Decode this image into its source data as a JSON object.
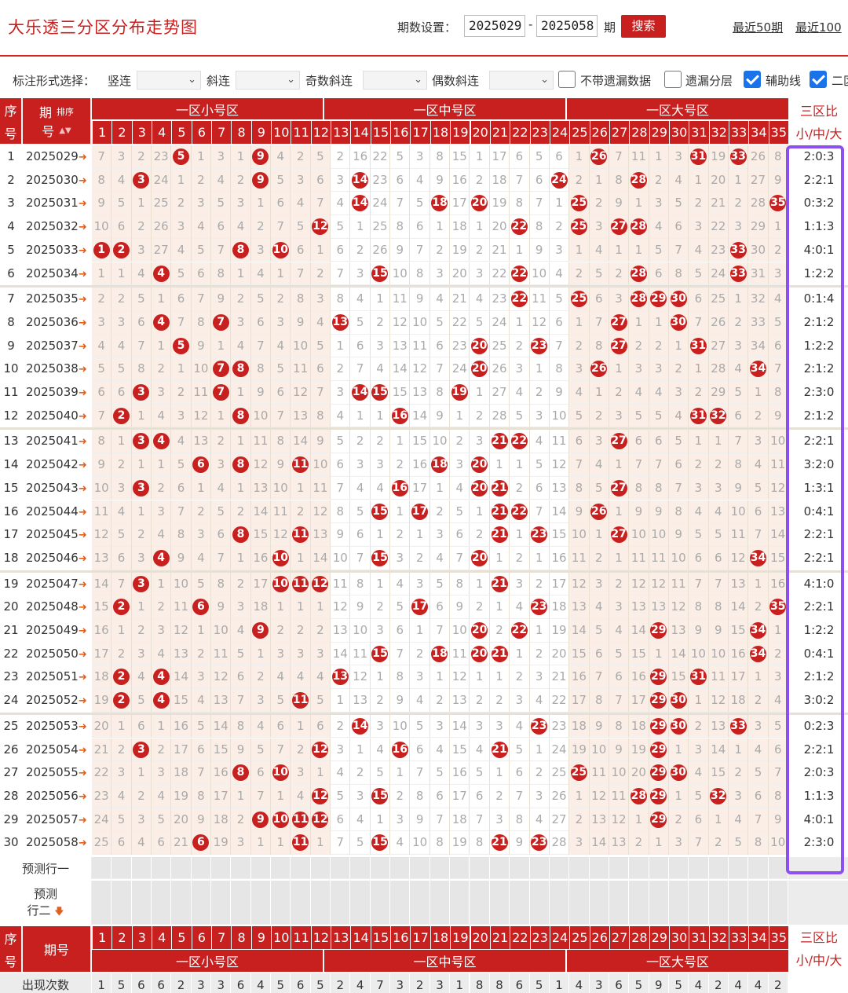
{
  "title": "大乐透三分区分布走势图",
  "period_label": "期数设置：",
  "period_from": "2025029",
  "period_dash": "-",
  "period_to": "2025058",
  "qi": "期",
  "search_label": "搜索",
  "link_recent50": "最近50期",
  "link_recent100": "最近100",
  "options": {
    "label": "标注形式选择：",
    "vertical": "竖连",
    "diagonal": "斜连",
    "odd_diagonal": "奇数斜连",
    "even_diagonal": "偶数斜连",
    "no_missing": "不带遗漏数据",
    "missing_layers": "遗漏分层",
    "aux_line": "辅助线",
    "second": "二区"
  },
  "colors": {
    "red": "#c81f1f",
    "purple": "#8c4ff0",
    "small_bg": "#fbeee6",
    "mid_bg": "#ffffff",
    "big_bg": "#fbeee6"
  },
  "header": {
    "seq_top": "序",
    "seq_bottom": "号",
    "period_top": "期",
    "period_bottom": "号",
    "sort": "排序",
    "zone_small": "一区小号区",
    "zone_mid": "一区中号区",
    "zone_big": "一区大号区",
    "ratio_top": "三区比",
    "ratio_bottom": "小/中/大"
  },
  "numbers": [
    "1",
    "2",
    "3",
    "4",
    "5",
    "6",
    "7",
    "8",
    "9",
    "10",
    "11",
    "12",
    "13",
    "14",
    "15",
    "16",
    "17",
    "18",
    "19",
    "20",
    "21",
    "22",
    "23",
    "24",
    "25",
    "26",
    "27",
    "28",
    "29",
    "30",
    "31",
    "32",
    "33",
    "34",
    "35"
  ],
  "rows": [
    {
      "seq": "1",
      "period": "2025029",
      "cells": [
        "7",
        "3",
        "2",
        "23",
        "*5",
        "1",
        "3",
        "1",
        "*9",
        "4",
        "2",
        "5",
        "2",
        "16",
        "22",
        "5",
        "3",
        "8",
        "15",
        "1",
        "17",
        "6",
        "5",
        "6",
        "1",
        "*26",
        "7",
        "11",
        "1",
        "3",
        "*31",
        "19",
        "*33",
        "26",
        "8"
      ],
      "ratio": "2:0:3"
    },
    {
      "seq": "2",
      "period": "2025030",
      "cells": [
        "8",
        "4",
        "*3",
        "24",
        "1",
        "2",
        "4",
        "2",
        "*9",
        "5",
        "3",
        "6",
        "3",
        "*14",
        "23",
        "6",
        "4",
        "9",
        "16",
        "2",
        "18",
        "7",
        "6",
        "*24",
        "2",
        "1",
        "8",
        "*28",
        "2",
        "4",
        "1",
        "20",
        "1",
        "27",
        "9"
      ],
      "ratio": "2:2:1"
    },
    {
      "seq": "3",
      "period": "2025031",
      "cells": [
        "9",
        "5",
        "1",
        "25",
        "2",
        "3",
        "5",
        "3",
        "1",
        "6",
        "4",
        "7",
        "4",
        "*14",
        "24",
        "7",
        "5",
        "*18",
        "17",
        "*20",
        "19",
        "8",
        "7",
        "1",
        "*25",
        "2",
        "9",
        "1",
        "3",
        "5",
        "2",
        "21",
        "2",
        "28",
        "*35"
      ],
      "ratio": "0:3:2"
    },
    {
      "seq": "4",
      "period": "2025032",
      "cells": [
        "10",
        "6",
        "2",
        "26",
        "3",
        "4",
        "6",
        "4",
        "2",
        "7",
        "5",
        "*12",
        "5",
        "1",
        "25",
        "8",
        "6",
        "1",
        "18",
        "1",
        "20",
        "*22",
        "8",
        "2",
        "*25",
        "3",
        "*27",
        "*28",
        "4",
        "6",
        "3",
        "22",
        "3",
        "29",
        "1"
      ],
      "ratio": "1:1:3"
    },
    {
      "seq": "5",
      "period": "2025033",
      "cells": [
        "*1",
        "*2",
        "3",
        "27",
        "4",
        "5",
        "7",
        "*8",
        "3",
        "*10",
        "6",
        "1",
        "6",
        "2",
        "26",
        "9",
        "7",
        "2",
        "19",
        "2",
        "21",
        "1",
        "9",
        "3",
        "1",
        "4",
        "1",
        "1",
        "5",
        "7",
        "4",
        "23",
        "*33",
        "30",
        "2"
      ],
      "ratio": "4:0:1"
    },
    {
      "seq": "6",
      "period": "2025034",
      "cells": [
        "1",
        "1",
        "4",
        "*4",
        "5",
        "6",
        "8",
        "1",
        "4",
        "1",
        "7",
        "2",
        "7",
        "3",
        "*15",
        "10",
        "8",
        "3",
        "20",
        "3",
        "22",
        "*22",
        "10",
        "4",
        "2",
        "5",
        "2",
        "*28",
        "6",
        "8",
        "5",
        "24",
        "*33",
        "31",
        "3"
      ],
      "ratio": "1:2:2"
    },
    {
      "seq": "7",
      "period": "2025035",
      "cells": [
        "2",
        "2",
        "5",
        "1",
        "6",
        "7",
        "9",
        "2",
        "5",
        "2",
        "8",
        "3",
        "8",
        "4",
        "1",
        "11",
        "9",
        "4",
        "21",
        "4",
        "23",
        "*22",
        "11",
        "5",
        "*25",
        "6",
        "3",
        "*28",
        "*29",
        "*30",
        "6",
        "25",
        "1",
        "32",
        "4"
      ],
      "ratio": "0:1:4"
    },
    {
      "seq": "8",
      "period": "2025036",
      "cells": [
        "3",
        "3",
        "6",
        "*4",
        "7",
        "8",
        "*7",
        "3",
        "6",
        "3",
        "9",
        "4",
        "*13",
        "5",
        "2",
        "12",
        "10",
        "5",
        "22",
        "5",
        "24",
        "1",
        "12",
        "6",
        "1",
        "7",
        "*27",
        "1",
        "1",
        "*30",
        "7",
        "26",
        "2",
        "33",
        "5"
      ],
      "ratio": "2:1:2"
    },
    {
      "seq": "9",
      "period": "2025037",
      "cells": [
        "4",
        "4",
        "7",
        "1",
        "*5",
        "9",
        "1",
        "4",
        "7",
        "4",
        "10",
        "5",
        "1",
        "6",
        "3",
        "13",
        "11",
        "6",
        "23",
        "*20",
        "25",
        "2",
        "*23",
        "7",
        "2",
        "8",
        "*27",
        "2",
        "2",
        "1",
        "*31",
        "27",
        "3",
        "34",
        "6"
      ],
      "ratio": "1:2:2"
    },
    {
      "seq": "10",
      "period": "2025038",
      "cells": [
        "5",
        "5",
        "8",
        "2",
        "1",
        "10",
        "*7",
        "*8",
        "8",
        "5",
        "11",
        "6",
        "2",
        "7",
        "4",
        "14",
        "12",
        "7",
        "24",
        "*20",
        "26",
        "3",
        "1",
        "8",
        "3",
        "*26",
        "1",
        "3",
        "3",
        "2",
        "1",
        "28",
        "4",
        "*34",
        "7"
      ],
      "ratio": "2:1:2"
    },
    {
      "seq": "11",
      "period": "2025039",
      "cells": [
        "6",
        "6",
        "*3",
        "3",
        "2",
        "11",
        "*7",
        "1",
        "9",
        "6",
        "12",
        "7",
        "3",
        "*14",
        "*15",
        "15",
        "13",
        "8",
        "*19",
        "1",
        "27",
        "4",
        "2",
        "9",
        "4",
        "1",
        "2",
        "4",
        "4",
        "3",
        "2",
        "29",
        "5",
        "1",
        "8"
      ],
      "ratio": "2:3:0"
    },
    {
      "seq": "12",
      "period": "2025040",
      "cells": [
        "7",
        "*2",
        "1",
        "4",
        "3",
        "12",
        "1",
        "*8",
        "10",
        "7",
        "13",
        "8",
        "4",
        "1",
        "1",
        "*16",
        "14",
        "9",
        "1",
        "2",
        "28",
        "5",
        "3",
        "10",
        "5",
        "2",
        "3",
        "5",
        "5",
        "4",
        "*31",
        "*32",
        "6",
        "2",
        "9"
      ],
      "ratio": "2:1:2"
    },
    {
      "seq": "13",
      "period": "2025041",
      "cells": [
        "8",
        "1",
        "*3",
        "*4",
        "4",
        "13",
        "2",
        "1",
        "11",
        "8",
        "14",
        "9",
        "5",
        "2",
        "2",
        "1",
        "15",
        "10",
        "2",
        "3",
        "*21",
        "*22",
        "4",
        "11",
        "6",
        "3",
        "*27",
        "6",
        "6",
        "5",
        "1",
        "1",
        "7",
        "3",
        "10"
      ],
      "ratio": "2:2:1"
    },
    {
      "seq": "14",
      "period": "2025042",
      "cells": [
        "9",
        "2",
        "1",
        "1",
        "5",
        "*6",
        "3",
        "*8",
        "12",
        "9",
        "*11",
        "10",
        "6",
        "3",
        "3",
        "2",
        "16",
        "*18",
        "3",
        "*20",
        "1",
        "1",
        "5",
        "12",
        "7",
        "4",
        "1",
        "7",
        "7",
        "6",
        "2",
        "2",
        "8",
        "4",
        "11"
      ],
      "ratio": "3:2:0"
    },
    {
      "seq": "15",
      "period": "2025043",
      "cells": [
        "10",
        "3",
        "*3",
        "2",
        "6",
        "1",
        "4",
        "1",
        "13",
        "10",
        "1",
        "11",
        "7",
        "4",
        "4",
        "*16",
        "17",
        "1",
        "4",
        "*20",
        "*21",
        "2",
        "6",
        "13",
        "8",
        "5",
        "*27",
        "8",
        "8",
        "7",
        "3",
        "3",
        "9",
        "5",
        "12"
      ],
      "ratio": "1:3:1"
    },
    {
      "seq": "16",
      "period": "2025044",
      "cells": [
        "11",
        "4",
        "1",
        "3",
        "7",
        "2",
        "5",
        "2",
        "14",
        "11",
        "2",
        "12",
        "8",
        "5",
        "*15",
        "1",
        "*17",
        "2",
        "5",
        "1",
        "*21",
        "*22",
        "7",
        "14",
        "9",
        "*26",
        "1",
        "9",
        "9",
        "8",
        "4",
        "4",
        "10",
        "6",
        "13"
      ],
      "ratio": "0:4:1"
    },
    {
      "seq": "17",
      "period": "2025045",
      "cells": [
        "12",
        "5",
        "2",
        "4",
        "8",
        "3",
        "6",
        "*8",
        "15",
        "12",
        "*11",
        "13",
        "9",
        "6",
        "1",
        "2",
        "1",
        "3",
        "6",
        "2",
        "*21",
        "1",
        "*23",
        "15",
        "10",
        "1",
        "*27",
        "10",
        "10",
        "9",
        "5",
        "5",
        "11",
        "7",
        "14"
      ],
      "ratio": "2:2:1"
    },
    {
      "seq": "18",
      "period": "2025046",
      "cells": [
        "13",
        "6",
        "3",
        "*4",
        "9",
        "4",
        "7",
        "1",
        "16",
        "*10",
        "1",
        "14",
        "10",
        "7",
        "*15",
        "3",
        "2",
        "4",
        "7",
        "*20",
        "1",
        "2",
        "1",
        "16",
        "11",
        "2",
        "1",
        "11",
        "11",
        "10",
        "6",
        "6",
        "12",
        "*34",
        "15"
      ],
      "ratio": "2:2:1"
    },
    {
      "seq": "19",
      "period": "2025047",
      "cells": [
        "14",
        "7",
        "*3",
        "1",
        "10",
        "5",
        "8",
        "2",
        "17",
        "*10",
        "*11",
        "*12",
        "11",
        "8",
        "1",
        "4",
        "3",
        "5",
        "8",
        "1",
        "*21",
        "3",
        "2",
        "17",
        "12",
        "3",
        "2",
        "12",
        "12",
        "11",
        "7",
        "7",
        "13",
        "1",
        "16"
      ],
      "ratio": "4:1:0"
    },
    {
      "seq": "20",
      "period": "2025048",
      "cells": [
        "15",
        "*2",
        "1",
        "2",
        "11",
        "*6",
        "9",
        "3",
        "18",
        "1",
        "1",
        "1",
        "12",
        "9",
        "2",
        "5",
        "*17",
        "6",
        "9",
        "2",
        "1",
        "4",
        "*23",
        "18",
        "13",
        "4",
        "3",
        "13",
        "13",
        "12",
        "8",
        "8",
        "14",
        "2",
        "*35"
      ],
      "ratio": "2:2:1"
    },
    {
      "seq": "21",
      "period": "2025049",
      "cells": [
        "16",
        "1",
        "2",
        "3",
        "12",
        "1",
        "10",
        "4",
        "*9",
        "2",
        "2",
        "2",
        "13",
        "10",
        "3",
        "6",
        "1",
        "7",
        "10",
        "*20",
        "2",
        "*22",
        "1",
        "19",
        "14",
        "5",
        "4",
        "14",
        "*29",
        "13",
        "9",
        "9",
        "15",
        "*34",
        "1"
      ],
      "ratio": "1:2:2"
    },
    {
      "seq": "22",
      "period": "2025050",
      "cells": [
        "17",
        "2",
        "3",
        "4",
        "13",
        "2",
        "11",
        "5",
        "1",
        "3",
        "3",
        "3",
        "14",
        "11",
        "*15",
        "7",
        "2",
        "*18",
        "11",
        "*20",
        "*21",
        "1",
        "2",
        "20",
        "15",
        "6",
        "5",
        "15",
        "1",
        "14",
        "10",
        "10",
        "16",
        "*34",
        "2"
      ],
      "ratio": "0:4:1"
    },
    {
      "seq": "23",
      "period": "2025051",
      "cells": [
        "18",
        "*2",
        "4",
        "*4",
        "14",
        "3",
        "12",
        "6",
        "2",
        "4",
        "4",
        "4",
        "*13",
        "12",
        "1",
        "8",
        "3",
        "1",
        "12",
        "1",
        "1",
        "2",
        "3",
        "21",
        "16",
        "7",
        "6",
        "16",
        "*29",
        "15",
        "*31",
        "11",
        "17",
        "1",
        "3"
      ],
      "ratio": "2:1:2"
    },
    {
      "seq": "24",
      "period": "2025052",
      "cells": [
        "19",
        "*2",
        "5",
        "*4",
        "15",
        "4",
        "13",
        "7",
        "3",
        "5",
        "*11",
        "5",
        "1",
        "13",
        "2",
        "9",
        "4",
        "2",
        "13",
        "2",
        "2",
        "3",
        "4",
        "22",
        "17",
        "8",
        "7",
        "17",
        "*29",
        "*30",
        "1",
        "12",
        "18",
        "2",
        "4"
      ],
      "ratio": "3:0:2"
    },
    {
      "seq": "25",
      "period": "2025053",
      "cells": [
        "20",
        "1",
        "6",
        "1",
        "16",
        "5",
        "14",
        "8",
        "4",
        "6",
        "1",
        "6",
        "2",
        "*14",
        "3",
        "10",
        "5",
        "3",
        "14",
        "3",
        "3",
        "4",
        "*23",
        "23",
        "18",
        "9",
        "8",
        "18",
        "*29",
        "*30",
        "2",
        "13",
        "*33",
        "3",
        "5"
      ],
      "ratio": "0:2:3"
    },
    {
      "seq": "26",
      "period": "2025054",
      "cells": [
        "21",
        "2",
        "*3",
        "2",
        "17",
        "6",
        "15",
        "9",
        "5",
        "7",
        "2",
        "*12",
        "3",
        "1",
        "4",
        "*16",
        "6",
        "4",
        "15",
        "4",
        "*21",
        "5",
        "1",
        "24",
        "19",
        "10",
        "9",
        "19",
        "*29",
        "1",
        "3",
        "14",
        "1",
        "4",
        "6"
      ],
      "ratio": "2:2:1"
    },
    {
      "seq": "27",
      "period": "2025055",
      "cells": [
        "22",
        "3",
        "1",
        "3",
        "18",
        "7",
        "16",
        "*8",
        "6",
        "*10",
        "3",
        "1",
        "4",
        "2",
        "5",
        "1",
        "7",
        "5",
        "16",
        "5",
        "1",
        "6",
        "2",
        "25",
        "*25",
        "11",
        "10",
        "20",
        "*29",
        "*30",
        "4",
        "15",
        "2",
        "5",
        "7"
      ],
      "ratio": "2:0:3"
    },
    {
      "seq": "28",
      "period": "2025056",
      "cells": [
        "23",
        "4",
        "2",
        "4",
        "19",
        "8",
        "17",
        "1",
        "7",
        "1",
        "4",
        "*12",
        "5",
        "3",
        "*15",
        "2",
        "8",
        "6",
        "17",
        "6",
        "2",
        "7",
        "3",
        "26",
        "1",
        "12",
        "11",
        "*28",
        "*29",
        "1",
        "5",
        "*32",
        "3",
        "6",
        "8"
      ],
      "ratio": "1:1:3"
    },
    {
      "seq": "29",
      "period": "2025057",
      "cells": [
        "24",
        "5",
        "3",
        "5",
        "20",
        "9",
        "18",
        "2",
        "*9",
        "*10",
        "*11",
        "*12",
        "6",
        "4",
        "1",
        "3",
        "9",
        "7",
        "18",
        "7",
        "3",
        "8",
        "4",
        "27",
        "2",
        "13",
        "12",
        "1",
        "*29",
        "2",
        "6",
        "1",
        "4",
        "7",
        "9"
      ],
      "ratio": "4:0:1"
    },
    {
      "seq": "30",
      "period": "2025058",
      "cells": [
        "25",
        "6",
        "4",
        "6",
        "21",
        "*6",
        "19",
        "3",
        "1",
        "1",
        "*11",
        "1",
        "7",
        "5",
        "*15",
        "4",
        "10",
        "8",
        "19",
        "8",
        "*21",
        "9",
        "*23",
        "28",
        "3",
        "14",
        "13",
        "2",
        "1",
        "3",
        "7",
        "2",
        "5",
        "8",
        "10"
      ],
      "ratio": "2:3:0"
    }
  ],
  "pred1": "预测行一",
  "pred2_top": "预测",
  "pred2_bottom": "行二",
  "footer": {
    "seq_top": "序",
    "seq_bottom": "号",
    "period": "期号",
    "ratio_top": "三区比",
    "ratio_bottom": "小/中/大",
    "count_label": "出现次数",
    "counts": [
      "1",
      "5",
      "6",
      "6",
      "2",
      "3",
      "3",
      "6",
      "4",
      "5",
      "6",
      "5",
      "2",
      "4",
      "7",
      "3",
      "2",
      "3",
      "1",
      "8",
      "8",
      "6",
      "5",
      "1",
      "4",
      "3",
      "6",
      "5",
      "9",
      "5",
      "4",
      "2",
      "4",
      "4",
      "2"
    ]
  }
}
